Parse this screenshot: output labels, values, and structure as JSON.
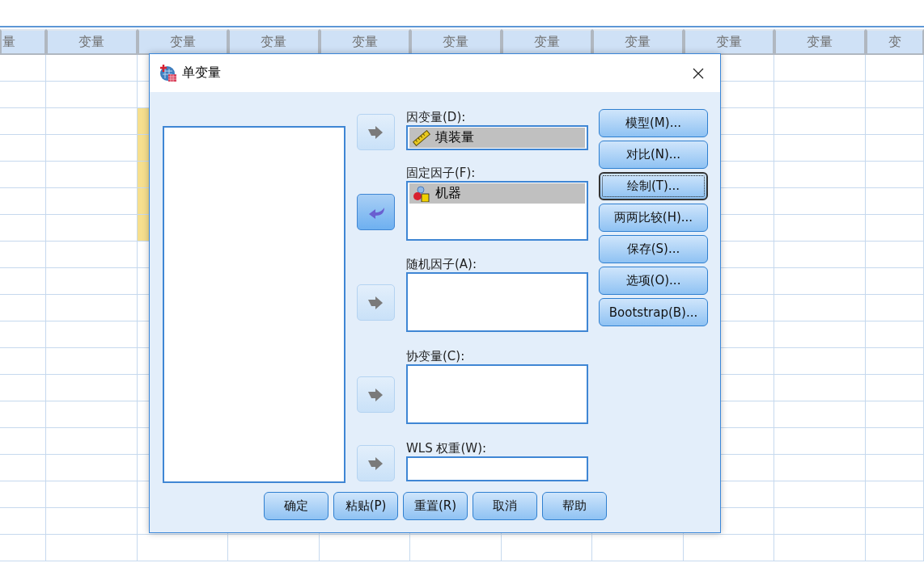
{
  "data_view": {
    "columns": [
      "量",
      "变量",
      "变量",
      "变量",
      "变量",
      "变量",
      "变量",
      "变量",
      "变量",
      "变量",
      "变"
    ],
    "rows": [
      {
        "highlighted": false
      },
      {
        "highlighted": false
      },
      {
        "highlighted": true
      },
      {
        "highlighted": true
      },
      {
        "highlighted": true
      },
      {
        "highlighted": true
      },
      {
        "highlighted": true
      },
      {
        "highlighted": false
      },
      {
        "highlighted": false
      },
      {
        "highlighted": false
      },
      {
        "highlighted": false
      },
      {
        "highlighted": false
      },
      {
        "highlighted": false
      },
      {
        "highlighted": false
      },
      {
        "highlighted": false
      },
      {
        "highlighted": false
      },
      {
        "highlighted": false
      },
      {
        "highlighted": false
      },
      {
        "highlighted": false
      }
    ]
  },
  "dialog": {
    "title": "单变量",
    "move_buttons": [
      {
        "disabled": true,
        "kind": "add"
      },
      {
        "disabled": false,
        "kind": "remove"
      },
      {
        "disabled": true,
        "kind": "add"
      },
      {
        "disabled": true,
        "kind": "add"
      },
      {
        "disabled": true,
        "kind": "add"
      }
    ],
    "fields": [
      {
        "label": "因变量(D):",
        "kind": "single",
        "items": [
          {
            "name": "填装量",
            "kind": "scale",
            "selected": true
          }
        ]
      },
      {
        "label": "固定因子(F):",
        "kind": "list",
        "items": [
          {
            "name": "机器",
            "kind": "nominal",
            "selected": true
          }
        ]
      },
      {
        "label": "随机因子(A):",
        "kind": "list"
      },
      {
        "label": "协变量(C):",
        "kind": "list"
      },
      {
        "label": "WLS 权重(W):",
        "kind": "single"
      }
    ],
    "side_buttons": [
      {
        "label": "模型(M)...",
        "focused": false
      },
      {
        "label": "对比(N)...",
        "focused": false
      },
      {
        "label": "绘制(T)...",
        "focused": true
      },
      {
        "label": "两两比较(H)...",
        "focused": false
      },
      {
        "label": "保存(S)...",
        "focused": false
      },
      {
        "label": "选项(O)...",
        "focused": false
      },
      {
        "label": "Bootstrap(B)...",
        "focused": false
      }
    ],
    "footer_buttons": [
      {
        "label": "确定"
      },
      {
        "label": "粘贴(P)"
      },
      {
        "label": "重置(R)"
      },
      {
        "label": "取消"
      },
      {
        "label": "帮助"
      }
    ]
  }
}
